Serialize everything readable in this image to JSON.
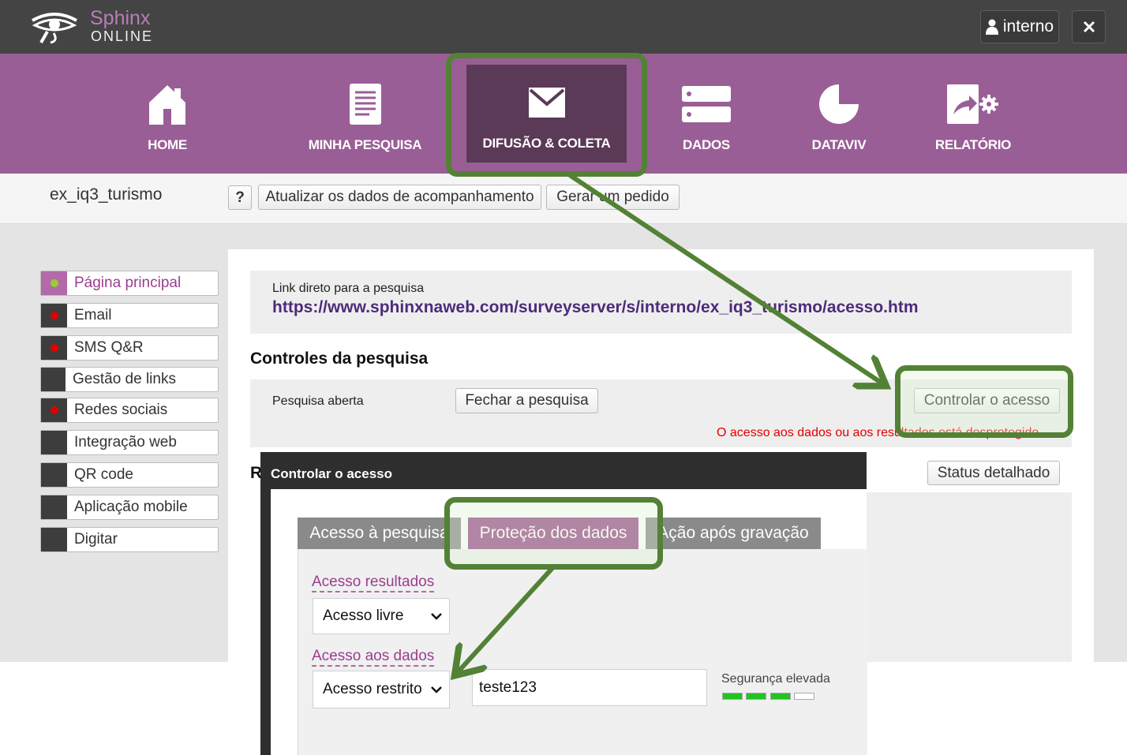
{
  "app": {
    "logo_name": "Sphinx",
    "logo_sub": "ONLINE",
    "user_label": "interno",
    "user_icon": "user-icon",
    "close_icon": "close-icon"
  },
  "nav": {
    "items": [
      {
        "label": "HOME",
        "icon": "home-icon"
      },
      {
        "label": "MINHA PESQUISA",
        "icon": "document-icon"
      },
      {
        "label": "DIFUSÃO & COLETA",
        "icon": "envelope-icon",
        "active": true
      },
      {
        "label": "DADOS",
        "icon": "database-icon"
      },
      {
        "label": "DATAVIV",
        "icon": "pie-chart-icon"
      },
      {
        "label": "RELATÓRIO",
        "icon": "report-icon"
      }
    ]
  },
  "subheader": {
    "survey_name": "ex_iq3_turismo",
    "help_label": "?",
    "update_label": "Atualizar os dados de acompanhamento",
    "order_label": "Gerar um pedido"
  },
  "sidebar": {
    "items": [
      {
        "label": "Página principal",
        "status": "active"
      },
      {
        "label": "Email",
        "status": "red"
      },
      {
        "label": "SMS Q&R",
        "status": "red"
      },
      {
        "label": "Gestão de links",
        "status": "none"
      },
      {
        "label": "Redes sociais",
        "status": "red"
      },
      {
        "label": "Integração web",
        "status": "none"
      },
      {
        "label": "QR code",
        "status": "none"
      },
      {
        "label": "Aplicação mobile",
        "status": "none"
      },
      {
        "label": "Digitar",
        "status": "none"
      }
    ]
  },
  "main": {
    "link_label": "Link direto para a pesquisa",
    "link_url": "https://www.sphinxnaweb.com/surveyserver/s/interno/ex_iq3_turismo/acesso.htm",
    "controls_title": "Controles da pesquisa",
    "status_label": "Pesquisa aberta",
    "close_survey_label": "Fechar a pesquisa",
    "control_access_label": "Controlar o acesso",
    "warning": "O acesso aos dados ou aos resultados está desprotegido",
    "results_title_initial": "R",
    "detailed_status_label": "Status detalhado"
  },
  "modal": {
    "title": "Controlar o acesso",
    "tabs": [
      {
        "label": "Acesso à pesquisa"
      },
      {
        "label": "Proteção dos dados",
        "active": true
      },
      {
        "label": "Ação após gravação"
      }
    ],
    "results_access_label": "Acesso resultados",
    "results_access_value": "Acesso livre",
    "data_access_label": "Acesso aos dados",
    "data_access_value": "Acesso restrito",
    "password_value": "teste123",
    "security_label": "Segurança elevada",
    "security_level": 3,
    "security_max": 4
  },
  "colors": {
    "topbar": "#444444",
    "nav": "#9a5e96",
    "nav_active": "#5a3a56",
    "accent": "#9a3e8f",
    "annotation": "#538135",
    "strength": "#22c322",
    "warning": "#e00000"
  }
}
